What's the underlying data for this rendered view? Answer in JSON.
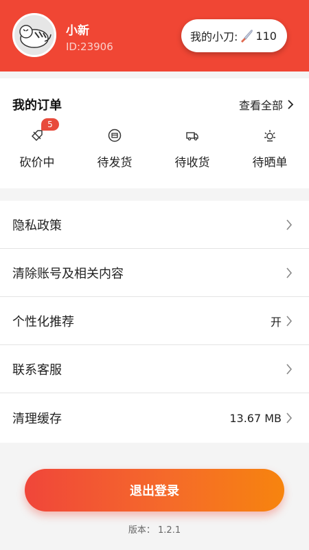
{
  "user": {
    "name": "小新",
    "id_text": "ID:23906"
  },
  "knife": {
    "label": "我的小刀:",
    "count": "110"
  },
  "orders": {
    "title": "我的订单",
    "view_all": "查看全部",
    "items": [
      {
        "label": "砍价中",
        "icon": "bargain-icon",
        "badge": "5"
      },
      {
        "label": "待发货",
        "icon": "pending-ship-icon"
      },
      {
        "label": "待收货",
        "icon": "truck-icon"
      },
      {
        "label": "待晒单",
        "icon": "sun-icon"
      }
    ]
  },
  "menu": [
    {
      "label": "隐私政策",
      "value": ""
    },
    {
      "label": "清除账号及相关内容",
      "value": ""
    },
    {
      "label": "个性化推荐",
      "value": "开"
    },
    {
      "label": "联系客服",
      "value": ""
    },
    {
      "label": "清理缓存",
      "value": "13.67 MB"
    }
  ],
  "logout_label": "退出登录",
  "version_text": "版本：  1.2.1",
  "colors": {
    "header_bg": "#f04634",
    "badge_bg": "#e84b3c",
    "logout_gradient_start": "#f0463a",
    "logout_gradient_end": "#f7840e"
  }
}
